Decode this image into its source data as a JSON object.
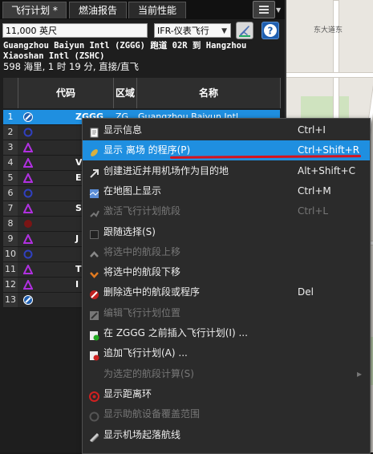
{
  "tabs": [
    "飞行计划 *",
    "燃油报告",
    "当前性能"
  ],
  "toolbar": {
    "altitude_value": "11,000 英尺",
    "flight_rules_value": "IFR-仪表飞行"
  },
  "route": {
    "line1": "Guangzhou Baiyun Intl (ZGGG) 跑道 02R 到 Hangzhou",
    "line2": "Xiaoshan Intl (ZSHC)",
    "line3": "598 海里, 1 时 19 分, 直接/直飞"
  },
  "table": {
    "columns": [
      "代码",
      "区域",
      "名称"
    ],
    "rows": [
      {
        "num": "1",
        "code": "ZGGG",
        "region": "ZG",
        "name": "Guangzhou Baiyun Intl",
        "icon": "airport-icon",
        "selected": true
      },
      {
        "num": "2",
        "code": "",
        "icon": "vor-icon"
      },
      {
        "num": "3",
        "code": "",
        "icon": "waypoint-icon"
      },
      {
        "num": "4",
        "code": "V",
        "icon": "waypoint-icon"
      },
      {
        "num": "5",
        "code": "E",
        "icon": "waypoint-icon"
      },
      {
        "num": "6",
        "code": "",
        "icon": "vor-icon"
      },
      {
        "num": "7",
        "code": "S",
        "icon": "waypoint-icon"
      },
      {
        "num": "8",
        "code": "",
        "icon": "ndb-icon"
      },
      {
        "num": "9",
        "code": "J",
        "icon": "waypoint-icon"
      },
      {
        "num": "10",
        "code": "",
        "icon": "vor-icon"
      },
      {
        "num": "11",
        "code": "T",
        "icon": "waypoint-icon"
      },
      {
        "num": "12",
        "code": "I",
        "icon": "waypoint-icon"
      },
      {
        "num": "13",
        "code": "",
        "icon": "airport-icon"
      }
    ]
  },
  "context_menu": [
    {
      "label": "显示信息",
      "shortcut": "Ctrl+I",
      "icon": "info-icon",
      "disabled": false
    },
    {
      "label": "显示 离场  的程序(P)",
      "shortcut": "Ctrl+Shift+R",
      "icon": "procedure-icon",
      "disabled": false,
      "highlighted": true
    },
    {
      "label": "创建进近并用机场作为目的地",
      "shortcut": "Alt+Shift+C",
      "icon": "approach-icon",
      "disabled": false
    },
    {
      "label": "在地图上显示",
      "shortcut": "Ctrl+M",
      "icon": "map-icon",
      "disabled": false
    },
    {
      "label": "激活飞行计划航段",
      "shortcut": "Ctrl+L",
      "icon": "activate-icon",
      "disabled": true
    },
    {
      "label": "跟随选择(S)",
      "shortcut": "",
      "icon": "checkbox-icon",
      "disabled": false
    },
    {
      "label": "将选中的航段上移",
      "shortcut": "",
      "icon": "move-up-icon",
      "disabled": true
    },
    {
      "label": "将选中的航段下移",
      "shortcut": "",
      "icon": "move-down-icon",
      "disabled": false
    },
    {
      "label": "删除选中的航段或程序",
      "shortcut": "Del",
      "icon": "delete-icon",
      "disabled": false
    },
    {
      "label": "编辑飞行计划位置",
      "shortcut": "",
      "icon": "edit-icon",
      "disabled": true
    },
    {
      "label": "在 ZGGG 之前插入飞行计划(I) ...",
      "shortcut": "",
      "icon": "insert-plan-icon",
      "disabled": false
    },
    {
      "label": "追加飞行计划(A) ...",
      "shortcut": "",
      "icon": "append-plan-icon",
      "disabled": false
    },
    {
      "label": "为选定的航段计算(S)",
      "shortcut": "",
      "icon": "calc-icon",
      "disabled": true,
      "submenu": true
    },
    {
      "label": "显示距离环",
      "shortcut": "",
      "icon": "range-rings-icon",
      "disabled": false
    },
    {
      "label": "显示助航设备覆盖范围",
      "shortcut": "",
      "icon": "navaid-range-icon",
      "disabled": true
    },
    {
      "label": "显示机场起落航线",
      "shortcut": "",
      "icon": "traffic-pattern-icon",
      "disabled": false
    }
  ],
  "map": {
    "label": "东大道东"
  },
  "colors": {
    "accent": "#1f8fe0",
    "annotation": "#d8121c",
    "waypoint": "#b030e0",
    "vor": "#3040c0"
  }
}
